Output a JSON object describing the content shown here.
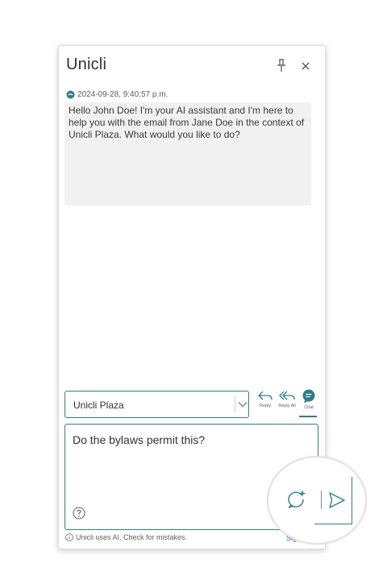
{
  "header": {
    "title": "Unicli",
    "pin_icon": "pin-icon",
    "close_icon": "close-icon"
  },
  "conversation": {
    "messages": [
      {
        "timestamp": "2024-09-28, 9:40:57 p.m.",
        "text": "Hello John Doe! I'm your AI assistant and I'm here to help you with the email from Jane Doe in the context of Unicli Plaza. What would you like to do?"
      }
    ]
  },
  "scope_select": {
    "value": "Unicli Plaza"
  },
  "actions": {
    "reply_label": "Reply",
    "reply_all_label": "Reply All",
    "chat_label": "Chat",
    "active": "Chat"
  },
  "compose": {
    "value": "Do the bylaws permit this?"
  },
  "footer": {
    "disclaimer": "Unicli uses AI. Check for mistakes.",
    "signin_partial": "Sig"
  },
  "colors": {
    "accent": "#2f7d8c",
    "bubble_bg": "#f1f1f1",
    "border": "#e1dfdd",
    "text": "#323130",
    "muted": "#605e5c"
  }
}
